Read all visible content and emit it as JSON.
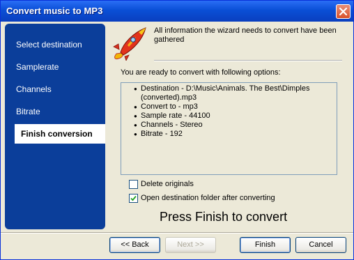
{
  "window": {
    "title": "Convert music to MP3"
  },
  "sidebar": {
    "items": [
      {
        "label": "Select destination"
      },
      {
        "label": "Samplerate"
      },
      {
        "label": "Channels"
      },
      {
        "label": "Bitrate"
      },
      {
        "label": "Finish conversion",
        "active": true
      }
    ]
  },
  "header": {
    "text": "All information the wizard needs to convert have been gathered"
  },
  "main": {
    "ready_label": "You are ready to convert with following options:",
    "options": {
      "destination_line1": "Destination - D:\\Music\\Animals. The Best\\Dimples",
      "destination_line2": "(converted).mp3",
      "convert_to": "Convert to - mp3",
      "sample_rate": "Sample rate - 44100",
      "channels": "Channels - Stereo",
      "bitrate": "Bitrate - 192"
    },
    "delete_originals": {
      "label": "Delete originals",
      "checked": false
    },
    "open_folder": {
      "label": "Open destination folder after converting",
      "checked": true
    },
    "press_finish": "Press Finish to convert"
  },
  "buttons": {
    "back": "<< Back",
    "next": ">> ",
    "next_label": "Next >>",
    "finish": "Finish",
    "cancel": "Cancel"
  },
  "colors": {
    "titlebar": "#0a4fd6",
    "sidebar": "#0b3e9a",
    "dialog_bg": "#ece9d8",
    "close_button": "#d9512b"
  }
}
